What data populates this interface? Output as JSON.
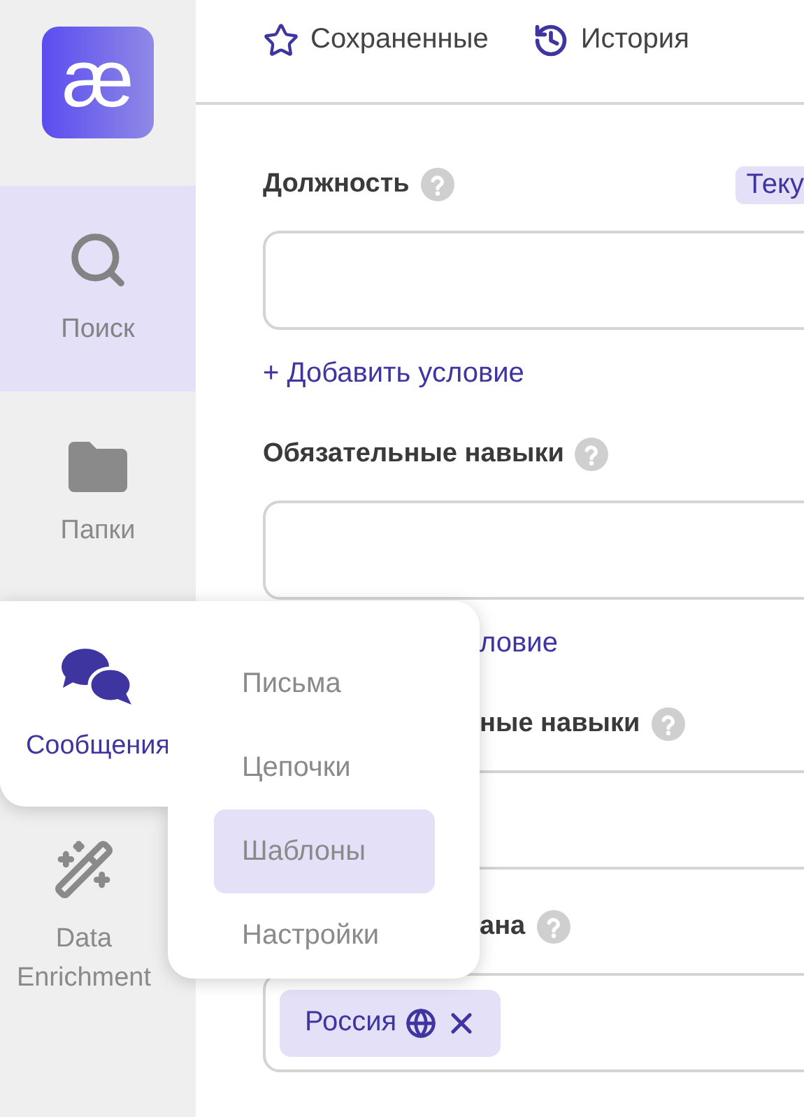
{
  "logo": {
    "text": "æ"
  },
  "topbar": {
    "items": [
      {
        "kind": "star",
        "label": "Сохраненные"
      },
      {
        "kind": "history",
        "label": "История"
      }
    ]
  },
  "sidebar": {
    "items": [
      {
        "kind": "search",
        "label": "Поиск",
        "selected": true,
        "expanded": false
      },
      {
        "kind": "folder",
        "label": "Папки",
        "selected": false,
        "expanded": false
      },
      {
        "kind": "chat",
        "label": "Сообщения",
        "selected": false,
        "expanded": true
      },
      {
        "kind": "wand",
        "label": "Data Enrichment",
        "selected": false,
        "expanded": false
      }
    ]
  },
  "submenu": {
    "items": [
      {
        "label": "Письма",
        "selected": false
      },
      {
        "label": "Цепочки",
        "selected": false
      },
      {
        "label": "Шаблоны",
        "selected": true
      },
      {
        "label": "Настройки",
        "selected": false
      }
    ]
  },
  "form": {
    "sections": [
      {
        "label": "Должность",
        "covered": false,
        "tag": "Теку",
        "link": "+ Добавить условие",
        "link_covered": false
      },
      {
        "label": "Обязательные навыки",
        "covered": false,
        "link": "ловие",
        "link_covered": true
      },
      {
        "label": "ные навыки",
        "covered": true
      },
      {
        "label": "ана",
        "covered": true,
        "chips": [
          {
            "text": "Россия"
          }
        ]
      }
    ]
  }
}
